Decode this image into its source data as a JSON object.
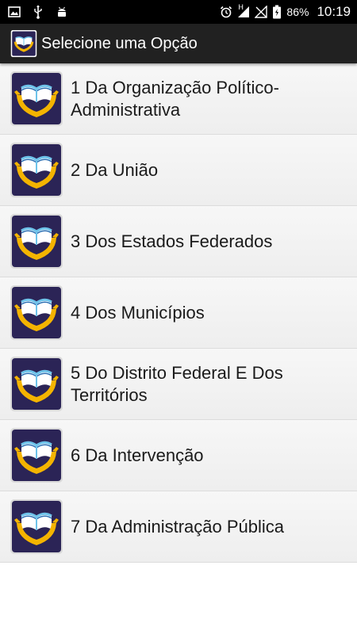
{
  "status_bar": {
    "left_icons": [
      "image-icon",
      "usb-icon",
      "android-icon"
    ],
    "right_icons": [
      "alarm-icon",
      "signal-h-icon",
      "no-signal-icon",
      "battery-icon"
    ],
    "signal_label": "H",
    "battery_percent": "86%",
    "clock": "10:19",
    "colors": {
      "background": "#000000",
      "text": "#ffffff"
    }
  },
  "app_bar": {
    "title": "Selecione uma Opção",
    "logo_icon": "open-book-hands-icon",
    "colors": {
      "background": "#212121",
      "text": "#ffffff"
    }
  },
  "menu": {
    "item_icon": "open-book-hands-icon",
    "colors": {
      "icon_background": "#2b2456",
      "book": "#6ec3ea",
      "hands": "#f4b400"
    },
    "items": [
      {
        "label": "1 Da Organização Político-Administrativa"
      },
      {
        "label": "2 Da União"
      },
      {
        "label": "3 Dos Estados Federados"
      },
      {
        "label": "4 Dos Municípios"
      },
      {
        "label": "5 Do Distrito Federal E Dos Territórios"
      },
      {
        "label": "6 Da Intervenção"
      },
      {
        "label": "7 Da Administração Pública"
      }
    ]
  }
}
